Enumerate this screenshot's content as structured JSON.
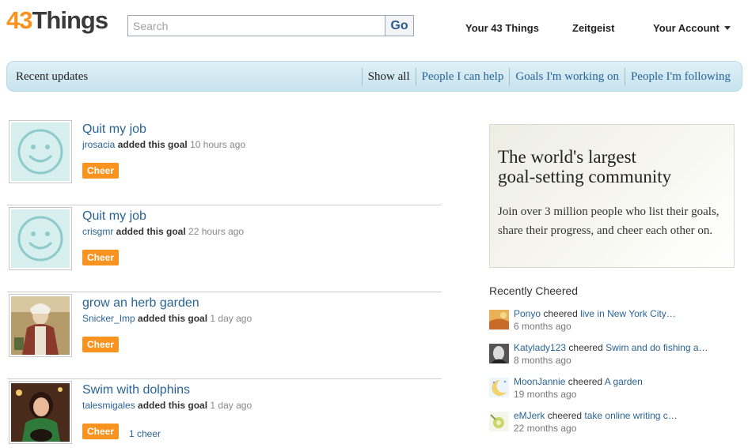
{
  "header": {
    "logo_num": "43",
    "logo_word": "Things",
    "search_placeholder": "Search",
    "search_button": "Go",
    "nav": [
      "Your 43 Things",
      "Zeitgeist",
      "Your Account"
    ]
  },
  "tabbar": {
    "title": "Recent updates",
    "tabs": [
      "Show all",
      "People I can help",
      "Goals I'm working on",
      "People I'm following"
    ],
    "active_tab": "Show all"
  },
  "feed": [
    {
      "title": "Quit my job",
      "user": "jrosacia",
      "action": "added this goal",
      "time": "10 hours ago",
      "cheer_label": "Cheer",
      "cheer_count": "",
      "avatar": "smiley-avatar-icon"
    },
    {
      "title": "Quit my job",
      "user": "crisgmr",
      "action": "added this goal",
      "time": "22 hours ago",
      "cheer_label": "Cheer",
      "cheer_count": "",
      "avatar": "smiley-avatar-icon"
    },
    {
      "title": "grow an herb garden",
      "user": "Snicker_Imp",
      "action": "added this goal",
      "time": "1 day ago",
      "cheer_label": "Cheer",
      "cheer_count": "",
      "avatar": "painting-avatar"
    },
    {
      "title": "Swim with dolphins",
      "user": "talesmigales",
      "action": "added this goal",
      "time": "1 day ago",
      "cheer_label": "Cheer",
      "cheer_count": "1 cheer",
      "avatar": "photo-avatar"
    }
  ],
  "promo": {
    "title_line1": "The world's largest",
    "title_line2": "goal-setting community",
    "body": "Join over 3 million people who list their goals, share their progress, and cheer each other on."
  },
  "recently_cheered": {
    "heading": "Recently Cheered",
    "items": [
      {
        "user": "Ponyo",
        "verb": "cheered",
        "goal": "live in New York City…",
        "time": "6 months ago"
      },
      {
        "user": "Katylady123",
        "verb": "cheered",
        "goal": "Swim and do fishing a…",
        "time": "8 months ago"
      },
      {
        "user": "MoonJannie",
        "verb": "cheered",
        "goal": "A garden",
        "time": "19 months ago"
      },
      {
        "user": "eMJerk",
        "verb": "cheered",
        "goal": "take online writing c…",
        "time": "22 months ago"
      }
    ]
  },
  "colors": {
    "accent_orange": "#f7931e",
    "link_blue": "#2a6496",
    "tabbar_bg": "#d4eaf2"
  }
}
